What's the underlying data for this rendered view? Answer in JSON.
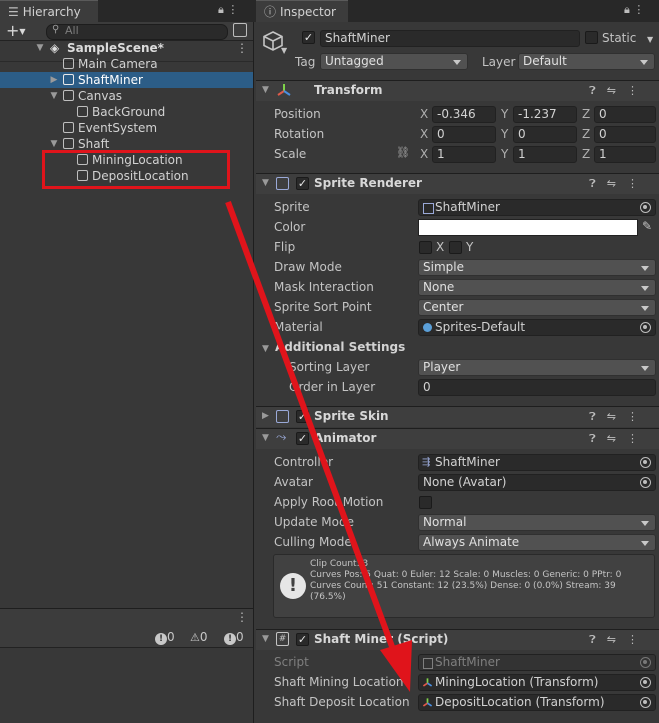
{
  "hierarchy": {
    "tab_label": "Hierarchy",
    "search_placeholder": "All",
    "add_label": "+",
    "scene_name": "SampleScene*",
    "items": [
      {
        "label": "Main Camera"
      },
      {
        "label": "ShaftMiner"
      },
      {
        "label": "Canvas"
      },
      {
        "label": "BackGround"
      },
      {
        "label": "EventSystem"
      },
      {
        "label": "Shaft"
      },
      {
        "label": "MiningLocation"
      },
      {
        "label": "DepositLocation"
      }
    ]
  },
  "console": {
    "info_count": "0",
    "warn_count": "0",
    "error_count": "0"
  },
  "inspector": {
    "tab_label": "Inspector",
    "object_name": "ShaftMiner",
    "static_label": "Static",
    "tag_label": "Tag",
    "tag_value": "Untagged",
    "layer_label": "Layer",
    "layer_value": "Default",
    "transform": {
      "title": "Transform",
      "position_label": "Position",
      "rotation_label": "Rotation",
      "scale_label": "Scale",
      "x": "X",
      "y": "Y",
      "z": "Z",
      "position": [
        "-0.346",
        "-1.237",
        "0"
      ],
      "rotation": [
        "0",
        "0",
        "0"
      ],
      "scale": [
        "1",
        "1",
        "1"
      ]
    },
    "sprite_renderer": {
      "title": "Sprite Renderer",
      "sprite_label": "Sprite",
      "sprite_value": "ShaftMiner",
      "color_label": "Color",
      "flip_label": "Flip",
      "flip_x": "X",
      "flip_y": "Y",
      "draw_mode_label": "Draw Mode",
      "draw_mode_value": "Simple",
      "mask_label": "Mask Interaction",
      "mask_value": "None",
      "sort_point_label": "Sprite Sort Point",
      "sort_point_value": "Center",
      "material_label": "Material",
      "material_value": "Sprites-Default",
      "additional_label": "Additional Settings",
      "sorting_layer_label": "Sorting Layer",
      "sorting_layer_value": "Player",
      "order_label": "Order in Layer",
      "order_value": "0"
    },
    "sprite_skin": {
      "title": "Sprite Skin"
    },
    "animator": {
      "title": "Animator",
      "controller_label": "Controller",
      "controller_value": "ShaftMiner",
      "avatar_label": "Avatar",
      "avatar_value": "None (Avatar)",
      "root_motion_label": "Apply Root Motion",
      "update_mode_label": "Update Mode",
      "update_mode_value": "Normal",
      "culling_label": "Culling Mode",
      "culling_value": "Always Animate",
      "info_line1": "Clip Count: 3",
      "info_line2": "Curves Pos: 5 Quat: 0 Euler: 12 Scale: 0 Muscles: 0 Generic: 0 PPtr: 0",
      "info_line3": "Curves Count: 51 Constant: 12 (23.5%) Dense: 0 (0.0%) Stream: 39",
      "info_line4": "(76.5%)"
    },
    "shaft_miner": {
      "title": "Shaft Miner (Script)",
      "script_label": "Script",
      "script_value": "ShaftMiner",
      "mining_label": "Shaft Mining Location",
      "mining_value": "MiningLocation (Transform)",
      "deposit_label": "Shaft Deposit Location",
      "deposit_value": "DepositLocation (Transform)"
    }
  },
  "colors": {
    "annotation": "#e0141b",
    "selection": "#2c5d87",
    "panel_bg": "#383838"
  }
}
